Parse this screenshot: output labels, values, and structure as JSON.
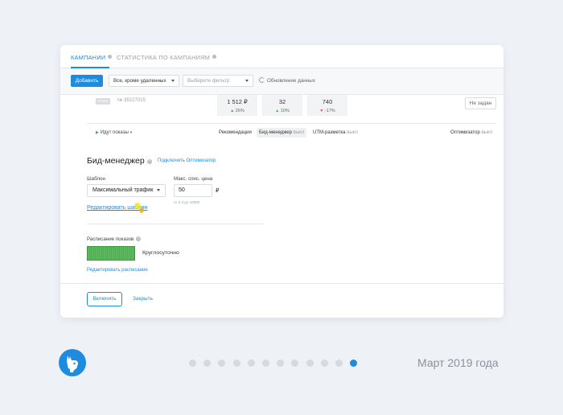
{
  "tabs": [
    {
      "label": "Кампании",
      "active": true
    },
    {
      "label": "Статистика по кампаниям",
      "active": false
    }
  ],
  "toolbar": {
    "add_label": "Добавить",
    "filter_value": "Все, кроме удаленных",
    "filter2_placeholder": "Выберите фильтр",
    "refresh_label": "Обновление данных"
  },
  "top_row": {
    "tag": "поиск",
    "ad_id": "№ 35227015",
    "stats": [
      {
        "value": "1 512 ₽",
        "delta": "26%",
        "direction": "up"
      },
      {
        "value": "32",
        "delta": "10%",
        "direction": "up"
      },
      {
        "value": "740",
        "delta": "-17%",
        "direction": "down"
      }
    ],
    "not_set_label": "Не задан"
  },
  "subnav": {
    "shows_label": "Идут показы",
    "items": [
      {
        "label": "Рекомендации",
        "state": ""
      },
      {
        "label": "Бид-менеджер",
        "state": "выкл",
        "active": true
      },
      {
        "label": "UTM-разметка",
        "state": "выкл"
      },
      {
        "label": "Оптимизатор",
        "state": "выкл"
      }
    ]
  },
  "bid_manager": {
    "title": "Бид-менеджер",
    "connect_link": "Подключить Оптимизатор",
    "template_label": "Шаблон",
    "template_value": "Максимальный трафик",
    "price_label": "Макс. спис. цена",
    "price_value": "50",
    "currency": "₽",
    "price_hint": "от 0.3 до 10000",
    "edit_template_link": "Редактировать шаблон"
  },
  "schedule": {
    "label": "Расписание показов",
    "value": "Круглосуточно",
    "edit_link": "Редактировать расписание"
  },
  "footer": {
    "enable_label": "Включить",
    "close_label": "Закрыть"
  },
  "pager": {
    "total": 12,
    "active_index": 11
  },
  "date_caption": "Март 2019 года",
  "colors": {
    "accent": "#1d8ce0",
    "positive": "#3caa3c",
    "negative": "#e04848",
    "schedule_green": "#5cb85c"
  }
}
